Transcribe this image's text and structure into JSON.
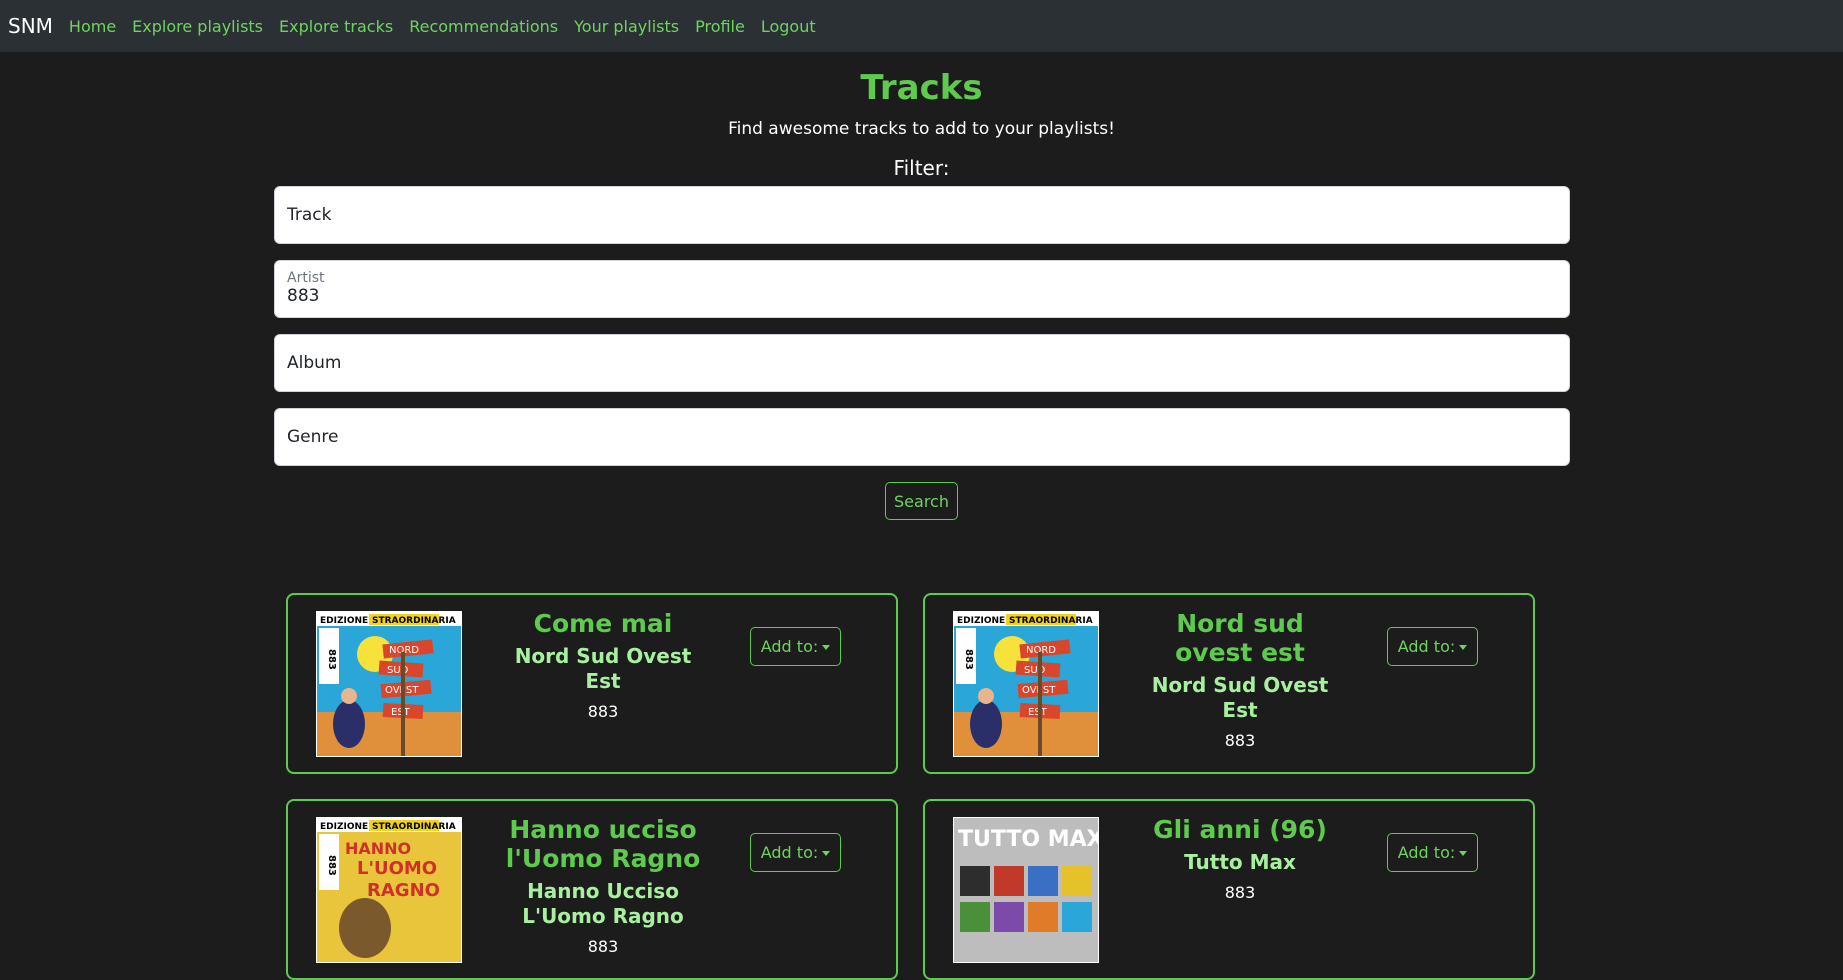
{
  "nav": {
    "brand": "SNM",
    "links": [
      "Home",
      "Explore playlists",
      "Explore tracks",
      "Recommendations",
      "Your playlists",
      "Profile",
      "Logout"
    ]
  },
  "header": {
    "title": "Tracks",
    "subtitle": "Find awesome tracks to add to your playlists!",
    "filter_label": "Filter:"
  },
  "filters": {
    "track": {
      "placeholder": "Track",
      "value": ""
    },
    "artist": {
      "label": "Artist",
      "value": "883"
    },
    "album": {
      "placeholder": "Album",
      "value": ""
    },
    "genre": {
      "placeholder": "Genre",
      "value": ""
    }
  },
  "search_label": "Search",
  "add_label": "Add to:",
  "cards": [
    {
      "title": "Come mai",
      "album": "Nord Sud Ovest Est",
      "artist": "883",
      "cover": "nord-sud-ovest-est-cover"
    },
    {
      "title": "Nord sud ovest est",
      "album": "Nord Sud Ovest Est",
      "artist": "883",
      "cover": "nord-sud-ovest-est-cover"
    },
    {
      "title": "Hanno ucciso l'Uomo Ragno",
      "album": "Hanno Ucciso L'Uomo Ragno",
      "artist": "883",
      "cover": "hanno-ucciso-cover"
    },
    {
      "title": "Gli anni (96)",
      "album": "Tutto Max",
      "artist": "883",
      "cover": "tutto-max-cover"
    }
  ],
  "cover_art": {
    "label_edizione": "EDIZIONE",
    "label_straordinaria": "STRAORDINARIA",
    "label_883": "883",
    "sign_nord": "NORD",
    "sign_sud": "SUD",
    "sign_ovest": "OVEST",
    "sign_est": "EST",
    "uomo_hanno": "HANNO",
    "uomo_luomo": "L'UOMO",
    "uomo_ragno": "RAGNO",
    "tutto": "TUTTO MAX"
  },
  "colors": {
    "background": "#1c1c1c",
    "navbar": "#2b3035",
    "accent": "#5ecb4e",
    "album_text": "#a8f0a0"
  }
}
